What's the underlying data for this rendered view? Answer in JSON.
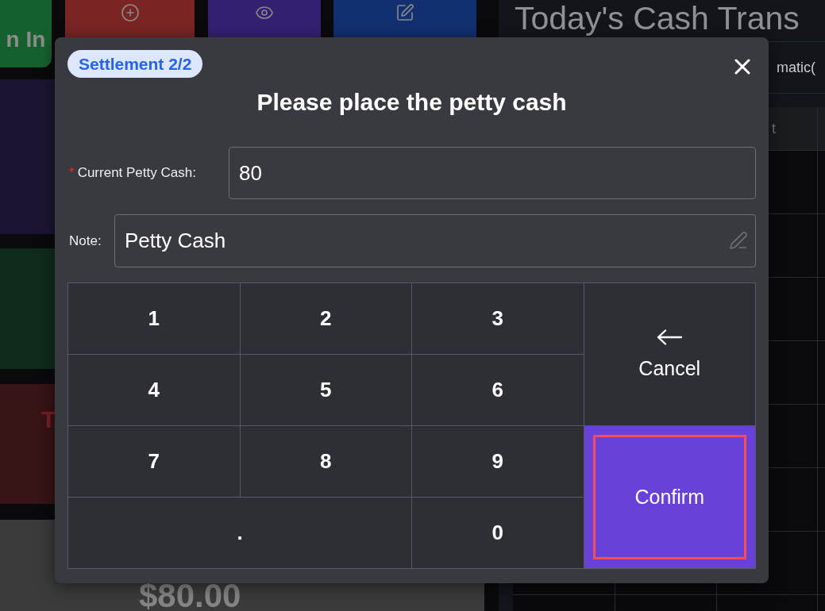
{
  "action_buttons": [
    {
      "label": "n In",
      "color": "#15612e"
    },
    {
      "color": "#7a2424"
    },
    {
      "color": "#342070"
    },
    {
      "color": "#122f70"
    }
  ],
  "side_cards": [
    {
      "color": "#1b1533"
    },
    {
      "color": "#0e2b1b"
    },
    {
      "color": "#371416",
      "label": "T"
    }
  ],
  "balance_panel": {
    "amount": "$80.00"
  },
  "transactions_panel": {
    "title": "Today's Cash Trans",
    "filter_text": "matic(",
    "table_header": {
      "column_3": "t"
    }
  },
  "dialog": {
    "step_badge": "Settlement 2/2",
    "title": "Please place the petty cash",
    "fields": [
      {
        "kind": "number",
        "marker": "*",
        "label": "Current Petty Cash:",
        "value": "80"
      },
      {
        "kind": "text",
        "label": "Note:",
        "value": "Petty Cash"
      }
    ],
    "keypad": {
      "keys": [
        {
          "kind": "digit",
          "label": "1",
          "wide": false,
          "highlighted": false
        },
        {
          "kind": "digit",
          "label": "2",
          "wide": false,
          "highlighted": false
        },
        {
          "kind": "digit",
          "label": "3",
          "wide": false,
          "highlighted": false
        },
        {
          "kind": "digit",
          "label": "4",
          "wide": false,
          "highlighted": false
        },
        {
          "kind": "digit",
          "label": "5",
          "wide": false,
          "highlighted": false
        },
        {
          "kind": "digit",
          "label": "6",
          "wide": false,
          "highlighted": false
        },
        {
          "kind": "digit",
          "label": "7",
          "wide": false,
          "highlighted": false
        },
        {
          "kind": "digit",
          "label": "8",
          "wide": false,
          "highlighted": false
        },
        {
          "kind": "digit",
          "label": "9",
          "wide": false,
          "highlighted": false
        },
        {
          "kind": "digit",
          "label": ".",
          "wide": true,
          "highlighted": false
        },
        {
          "kind": "digit",
          "label": "0",
          "wide": false,
          "highlighted": false
        },
        {
          "kind": "cancel",
          "label": "Cancel",
          "highlighted": false
        },
        {
          "kind": "confirm",
          "label": "Confirm",
          "highlighted": true
        }
      ]
    }
  }
}
